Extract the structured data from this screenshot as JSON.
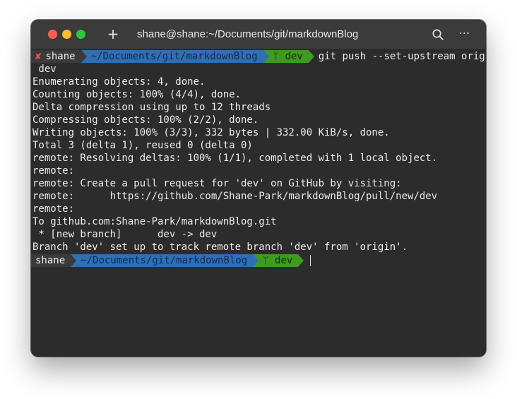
{
  "window": {
    "title": "shane@shane:~/Documents/git/markdownBlog",
    "new_tab_icon": "plus-icon",
    "search_icon": "search-icon",
    "more_icon": "more-icon"
  },
  "prompt": {
    "status_symbol": "✘",
    "user": "shane",
    "directory": "~/Documents/git/markdownBlog",
    "branch": "ᛘ dev",
    "colors": {
      "user_bg": "#3a3a3a",
      "dir_bg": "#2e6fb5",
      "branch_bg": "#3d9b1f",
      "error": "#ff4d4d"
    }
  },
  "command": "git push --set-upstream origin",
  "command_wrap": " dev",
  "output": [
    "Enumerating objects: 4, done.",
    "Counting objects: 100% (4/4), done.",
    "Delta compression using up to 12 threads",
    "Compressing objects: 100% (2/2), done.",
    "Writing objects: 100% (3/3), 332 bytes | 332.00 KiB/s, done.",
    "Total 3 (delta 1), reused 0 (delta 0)",
    "remote: Resolving deltas: 100% (1/1), completed with 1 local object.",
    "remote:",
    "remote: Create a pull request for 'dev' on GitHub by visiting:",
    "remote:      https://github.com/Shane-Park/markdownBlog/pull/new/dev",
    "remote:",
    "To github.com:Shane-Park/markdownBlog.git",
    " * [new branch]      dev -> dev",
    "Branch 'dev' set up to track remote branch 'dev' from 'origin'."
  ]
}
